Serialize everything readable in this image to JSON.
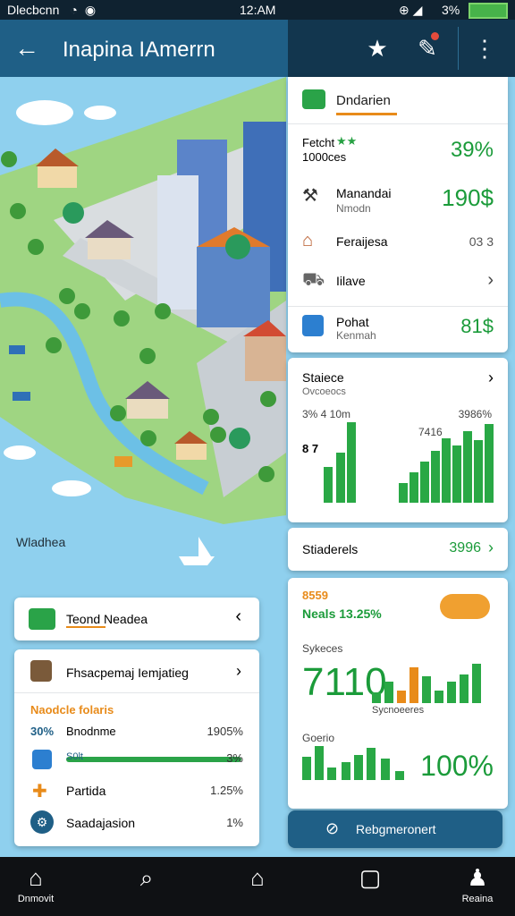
{
  "status": {
    "carrier": "Dlecbcnn",
    "time": "12:AM",
    "battery": "3%"
  },
  "appbar": {
    "title": "Inapina IAmerrn"
  },
  "map": {
    "label": "Wladhea"
  },
  "panel_main": {
    "header": "Dndarien",
    "rows": [
      {
        "label": "Fetcht",
        "sub": "1000ces",
        "value": "39%"
      },
      {
        "label": "Manandai",
        "sub": "Nmodn",
        "value": "190$"
      },
      {
        "label": "Feraijesa",
        "sub": "",
        "value": "03 3"
      },
      {
        "label": "Iilave",
        "sub": "",
        "value": "›"
      },
      {
        "label": "Pohat",
        "sub": "Kenmah",
        "value": "81$"
      }
    ]
  },
  "panel_stats": {
    "title": "Staiece",
    "sub": "Ovcoeocs",
    "left_label": "3% 4 10m",
    "left_value": "8 7",
    "right_label": "3986%",
    "right_value": "7416"
  },
  "panel_stat_footer": {
    "label": "Stiaderels",
    "value": "3996"
  },
  "panel_trend": {
    "top_a": "8559",
    "top_b": "Neals 13.25%",
    "section1": "Sykeces",
    "big1": "7110",
    "axis": "Sycnoeeres",
    "section2": "Goerio",
    "big2": "100%",
    "button": "Rebgmeronert"
  },
  "left_card_1": {
    "title": "Teond Neadea"
  },
  "left_card_2": {
    "title": "Fhsacpemaj Iemjatieg",
    "sub": "Naodcle folaris",
    "rows": [
      {
        "badge": "30%",
        "label": "Bnodnme",
        "value": "1905%"
      },
      {
        "badge": "S0lt",
        "label": "",
        "value": "3%"
      },
      {
        "badge": "",
        "label": "Partida",
        "value": "1.25%"
      },
      {
        "badge": "",
        "label": "Saadajasion",
        "value": "1%"
      }
    ]
  },
  "nav": [
    {
      "label": "Dnmovit"
    },
    {
      "label": ""
    },
    {
      "label": ""
    },
    {
      "label": ""
    },
    {
      "label": "Reaina"
    }
  ],
  "colors": {
    "accent": "#1f5f86",
    "green": "#1b9b3a",
    "orange": "#e88b1a"
  }
}
